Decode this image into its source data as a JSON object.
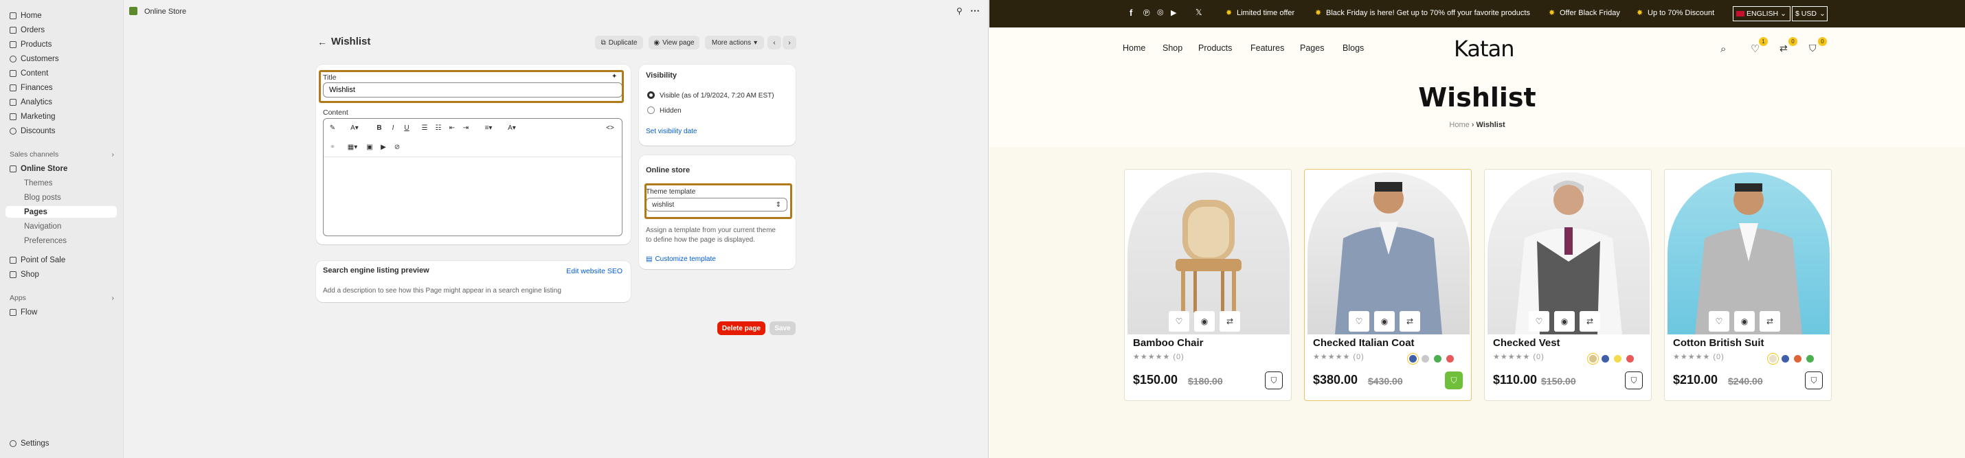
{
  "admin": {
    "nav": {
      "home": "Home",
      "orders": "Orders",
      "products": "Products",
      "customers": "Customers",
      "content": "Content",
      "finances": "Finances",
      "analytics": "Analytics",
      "marketing": "Marketing",
      "discounts": "Discounts"
    },
    "sales_channels": {
      "title": "Sales channels",
      "online_store": "Online Store",
      "themes": "Themes",
      "blog_posts": "Blog posts",
      "pages": "Pages",
      "navigation": "Navigation",
      "preferences": "Preferences",
      "pos": "Point of Sale",
      "shop": "Shop"
    },
    "apps": {
      "title": "Apps",
      "flow": "Flow"
    },
    "settings": "Settings",
    "topbar": {
      "store": "Online Store"
    },
    "page": {
      "title": "Wishlist",
      "duplicate": "Duplicate",
      "view_page": "View page",
      "more_actions": "More actions"
    },
    "form": {
      "title_label": "Title",
      "title_value": "Wishlist",
      "content_label": "Content"
    },
    "seo": {
      "title": "Search engine listing preview",
      "edit": "Edit website SEO",
      "desc": "Add a description to see how this Page might appear in a search engine listing"
    },
    "visibility": {
      "title": "Visibility",
      "visible": "Visible (as of 1/9/2024, 7:20 AM EST)",
      "hidden": "Hidden",
      "set_date": "Set visibility date"
    },
    "online_store": {
      "title": "Online store",
      "template_label": "Theme template",
      "template_value": "wishlist",
      "help1": "Assign a template from your current theme",
      "help2": "to define how the page is displayed.",
      "customize": "Customize template"
    },
    "footer": {
      "delete": "Delete page",
      "save": "Save"
    }
  },
  "store": {
    "announcements": [
      "Limited time offer",
      "Black Friday is here! Get up to 70% off your favorite products",
      "Offer Black Friday",
      "Up to 70% Discount"
    ],
    "language": "ENGLISH",
    "currency": "$ USD",
    "menu": [
      "Home",
      "Shop",
      "Products",
      "Features",
      "Pages",
      "Blogs"
    ],
    "logo": "Katan",
    "counts": {
      "wishlist": "1",
      "compare": "0",
      "cart": "0"
    },
    "page_title": "Wishlist",
    "breadcrumb": {
      "home": "Home",
      "current": "Wishlist"
    },
    "products": [
      {
        "name": "Bamboo Chair",
        "reviews": "(0)",
        "price": "$150.00",
        "compare": "$180.00"
      },
      {
        "name": "Checked Italian Coat",
        "reviews": "(0)",
        "price": "$380.00",
        "compare": "$430.00"
      },
      {
        "name": "Checked Vest",
        "reviews": "(0)",
        "price": "$110.00",
        "compare": "$150.00"
      },
      {
        "name": "Cotton British Suit",
        "reviews": "(0)",
        "price": "$210.00",
        "compare": "$240.00"
      }
    ],
    "colors": {
      "accent": "#f5c518",
      "dark": "#2b230e",
      "bag_active": "#6fbf3b",
      "highlight": "#b07a1a",
      "danger": "#e51c00"
    }
  }
}
